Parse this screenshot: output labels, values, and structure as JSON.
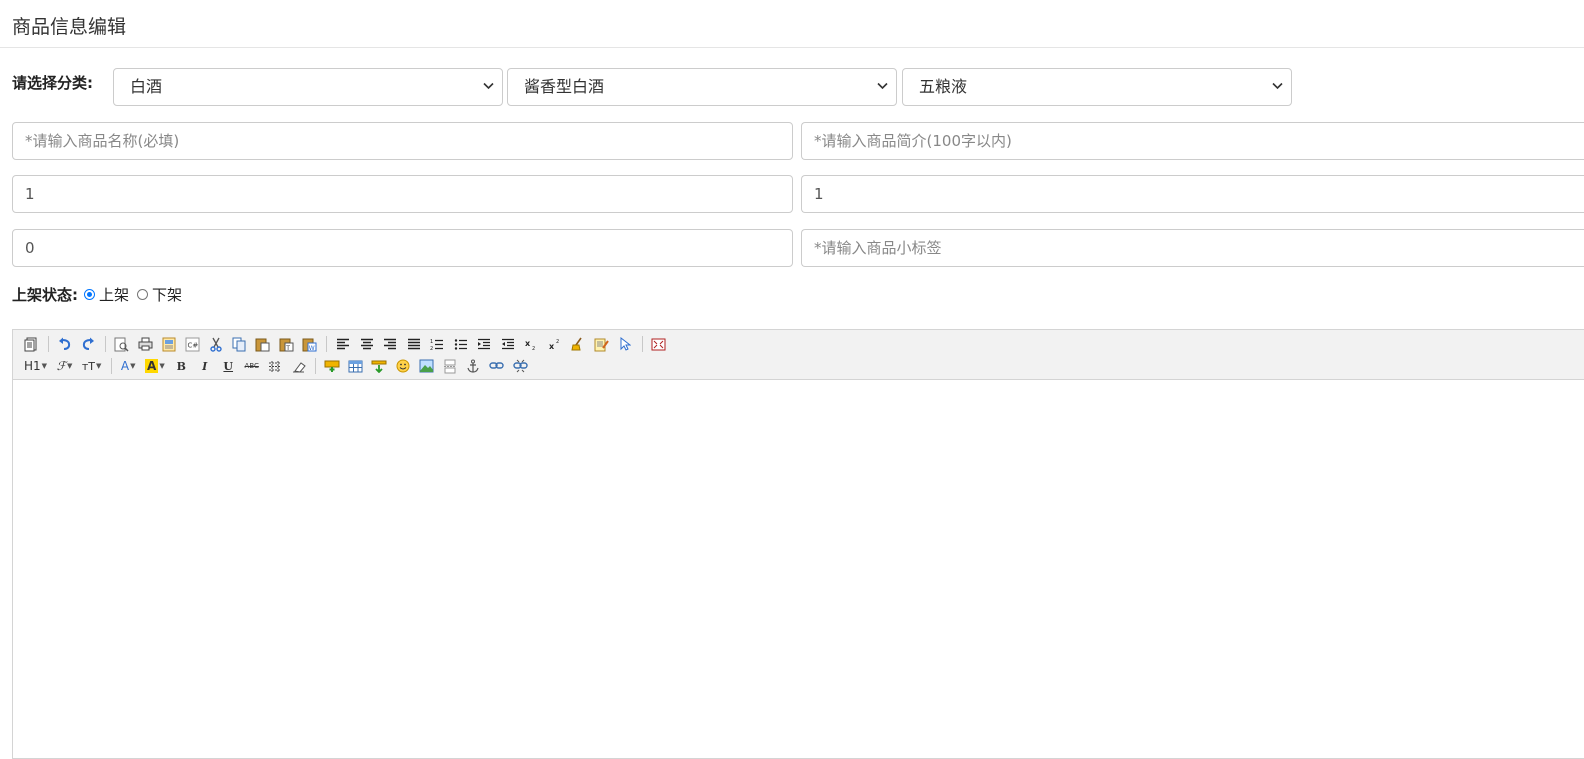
{
  "header": {
    "title": "商品信息编辑"
  },
  "category": {
    "label": "请选择分类:",
    "level1": "白酒",
    "level2": "酱香型白酒",
    "level3": "五粮液"
  },
  "fields": {
    "name_placeholder": "*请输入商品名称(必填)",
    "intro_placeholder": "*请输入商品简介(100字以内)",
    "row2_left_value": "1",
    "row2_right_value": "1",
    "row3_left_value": "0",
    "tag_placeholder": "*请输入商品小标签"
  },
  "status": {
    "label": "上架状态:",
    "on_label": "上架",
    "off_label": "下架",
    "selected": "上架"
  },
  "editor": {
    "toolbar_row1": [
      "source-icon",
      "undo-icon",
      "redo-icon",
      "preview-icon",
      "print-icon",
      "template-icon",
      "insert-code-icon",
      "cut-icon",
      "copy-icon",
      "paste-icon",
      "paste-text-icon",
      "paste-word-icon",
      "align-left-icon",
      "align-center-icon",
      "align-right-icon",
      "align-justify-icon",
      "ordered-list-icon",
      "unordered-list-icon",
      "indent-icon",
      "outdent-icon",
      "subscript-icon",
      "superscript-icon",
      "clear-html-icon",
      "quick-format-icon",
      "select-all-icon",
      "fullscreen-icon"
    ],
    "heading_label": "H1",
    "font_family_label": "ℱ",
    "font_size_label": "тT",
    "font_color_label": "A",
    "highlight_label": "A",
    "bold_label": "B",
    "italic_label": "I",
    "underline_label": "U",
    "strike_label": "ABC",
    "colors": {
      "highlight": "#ffd800",
      "font_color": "#2f6fd0"
    }
  }
}
